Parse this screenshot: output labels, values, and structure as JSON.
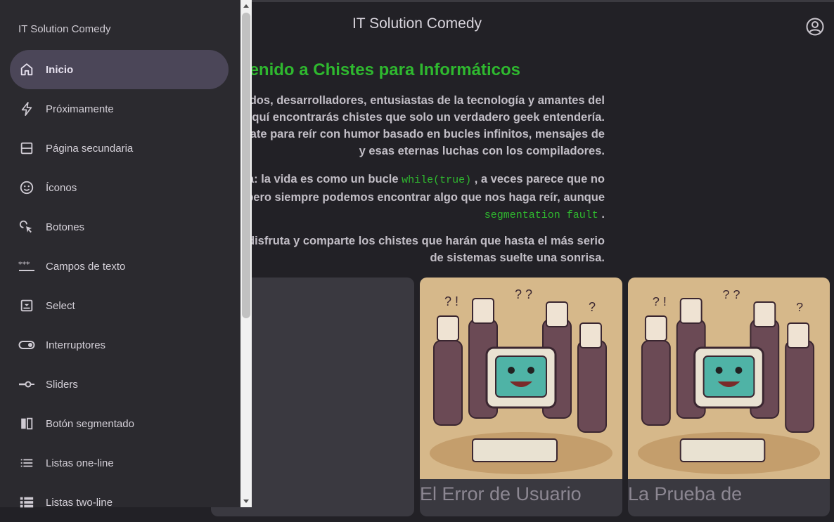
{
  "app": {
    "title": "IT Solution Comedy"
  },
  "main": {
    "heading": "enido a Chistes para Informáticos",
    "para1": [
      "enidos, desarrolladores, entusiastas de la tecnología y amantes del",
      "! Aquí encontrarás chistes que solo un verdadero geek entendería.",
      "ate para reír con humor basado en bucles infinitos, mensajes de",
      "y esas eternas luchas con los compiladores."
    ],
    "para2": {
      "l1_pre": "rda: la vida es como un bucle",
      "l1_code": "while(true)",
      "l1_post": ", a veces parece que no",
      "l2": "in, pero siempre podemos encontrar algo que nos haga reír, aunque",
      "l3_code": "segmentation fault",
      "l3_post": "."
    },
    "para3": [
      "a, disfruta y comparte los chistes que harán que hasta el más serio",
      "de sistemas suelte una sonrisa."
    ],
    "cards": [
      {
        "title": "El Error de Usuario"
      },
      {
        "title": "La Prueba de"
      }
    ]
  },
  "drawer": {
    "title": "IT Solution Comedy",
    "items": [
      {
        "label": "Inicio",
        "icon": "home-icon",
        "active": true
      },
      {
        "label": "Próximamente",
        "icon": "bolt-icon"
      },
      {
        "label": "Página secundaria",
        "icon": "split-page-icon"
      },
      {
        "label": "Íconos",
        "icon": "smiley-icon"
      },
      {
        "label": "Botones",
        "icon": "touch-icon"
      },
      {
        "label": "Campos de texto",
        "icon": "password-field-icon"
      },
      {
        "label": "Select",
        "icon": "select-box-icon"
      },
      {
        "label": "Interruptores",
        "icon": "toggle-icon"
      },
      {
        "label": "Sliders",
        "icon": "slider-icon"
      },
      {
        "label": "Botón segmentado",
        "icon": "segmented-icon"
      },
      {
        "label": "Listas one-line",
        "icon": "list-icon"
      },
      {
        "label": "Listas two-line",
        "icon": "list-bullets-icon"
      }
    ]
  },
  "colors": {
    "accent": "#2fb82f",
    "drawer_bg": "#2b2a2f",
    "active_bg": "#4b4658",
    "page_bg": "#222126"
  }
}
